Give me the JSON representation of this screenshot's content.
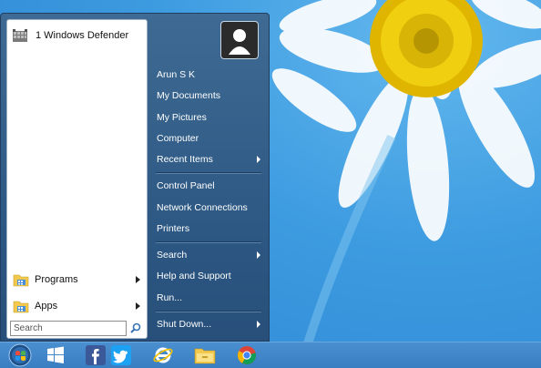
{
  "start_menu": {
    "pinned": [
      {
        "label": "1 Windows Defender",
        "icon": "windows-defender-icon"
      }
    ],
    "bottom_items": [
      {
        "label": "Programs",
        "icon": "folder-icon"
      },
      {
        "label": "Apps",
        "icon": "folder-icon"
      }
    ],
    "search": {
      "placeholder": "Search",
      "icon": "magnifier-icon"
    },
    "user": {
      "name": "Arun S K",
      "icon": "user-avatar-icon"
    },
    "right_items": {
      "my_documents": "My Documents",
      "my_pictures": "My Pictures",
      "computer": "Computer",
      "recent_items": "Recent Items",
      "control_panel": "Control Panel",
      "network_connections": "Network Connections",
      "printers": "Printers",
      "search": "Search",
      "help_and_support": "Help and Support",
      "run": "Run...",
      "shut_down": "Shut Down..."
    }
  },
  "taskbar": {
    "items": [
      "start-orb-icon",
      "windows-store-icon",
      "facebook-icon",
      "twitter-icon",
      "internet-explorer-icon",
      "file-explorer-icon",
      "chrome-icon"
    ]
  },
  "colors": {
    "menu_blue": "#2f5b86",
    "taskbar_blue": "#3a7ec2",
    "desktop_blue": "#3d9be0"
  }
}
